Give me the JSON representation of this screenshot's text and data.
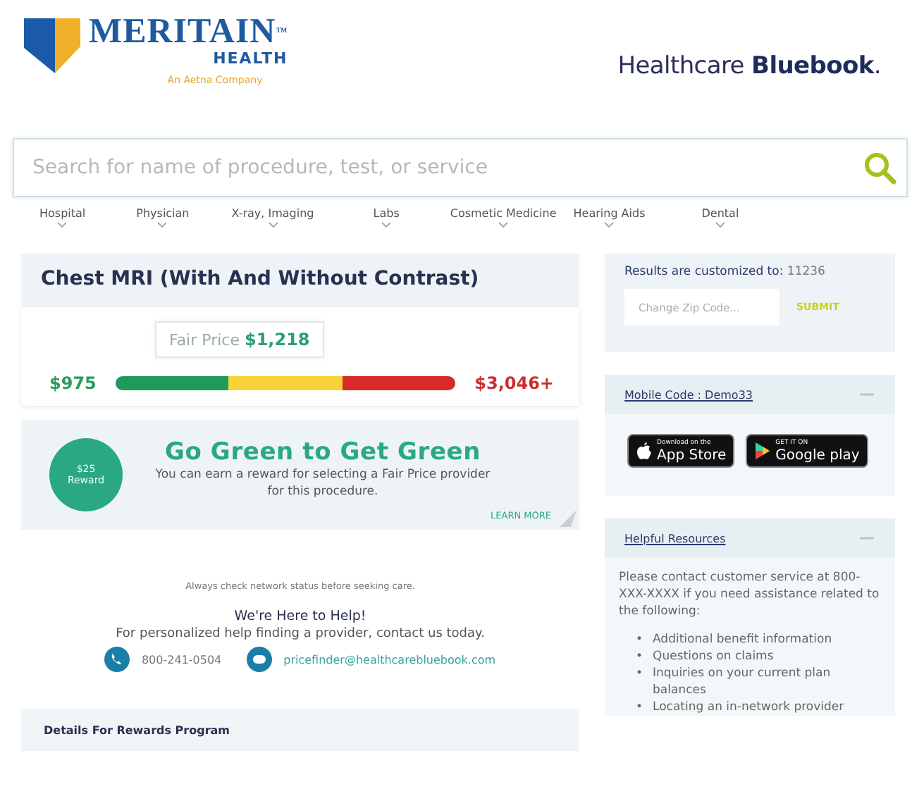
{
  "brand": {
    "name": "MERITAIN",
    "trademark": "™",
    "sub": "HEALTH",
    "tagline": "An Aetna Company"
  },
  "partner": {
    "name": "Healthcare **Bluebook**."
  },
  "search": {
    "placeholder": "Search for name of procedure, test, or service"
  },
  "categories": [
    "Hospital",
    "Physician",
    "X-ray, Imaging",
    "Labs",
    "Cosmetic Medicine",
    "Hearing Aids",
    "Dental"
  ],
  "procedure": {
    "title": "Chest MRI (With And Without Contrast)",
    "fair_price_label": "Fair Price",
    "fair_price": "$1,218",
    "low": "$975",
    "high": "$3,046+"
  },
  "reward": {
    "badge": "$25 Reward",
    "title": "Go Green to Get Green",
    "text": "You can earn a reward for selecting a Fair Price provider for this procedure.",
    "link": "LEARN MORE"
  },
  "note": "Always check network status before seeking care.",
  "help": {
    "title": "We're Here to Help!",
    "text": "For personalized help finding a provider, contact us today.",
    "phone": "800-241-0504",
    "email": "pricefinder@healthcarebluebook.com"
  },
  "rewards_details": {
    "title": "Details For Rewards Program"
  },
  "zip": {
    "label": "Results are customized to:",
    "zip": "11236",
    "placeholder": "Change Zip Code...",
    "button": "SUBMIT"
  },
  "mobile": {
    "title": "Mobile Code : Demo33",
    "expanded": true,
    "stores": [
      {
        "kind": "apple",
        "small": "Download on the",
        "big": "App Store"
      },
      {
        "kind": "google",
        "small": "GET IT ON",
        "big": "Google play"
      }
    ]
  },
  "resources": {
    "title": "Helpful Resources",
    "expanded": true,
    "marker": "•",
    "text": "Please contact customer service at 800-XXX-XXXX if you need assistance related to the following:",
    "items": [
      "Additional benefit information",
      "Questions on claims",
      "Inquiries on your current plan balances",
      "Locating an in-network provider"
    ]
  }
}
